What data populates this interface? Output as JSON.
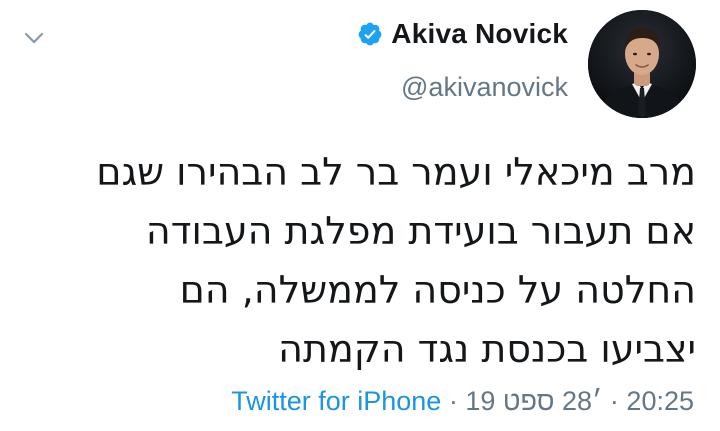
{
  "tweet": {
    "author": {
      "display_name": "Akiva Novick",
      "handle": "@akivanovick",
      "verified": true,
      "avatar_icon": "profile-photo"
    },
    "text_lines": [
      "מרב מיכאלי ועמר בר לב הבהירו שגם",
      "אם תעבור בועידת מפלגת העבודה",
      "החלטה על כניסה לממשלה, הם",
      "יצביעו בכנסת נגד הקמתה"
    ],
    "time": "20:25",
    "date": "19 ׳28 ספט",
    "source": "Twitter for iPhone",
    "separator": "·",
    "menu_icon": "chevron-down-icon",
    "colors": {
      "text": "#14171a",
      "secondary": "#657786",
      "link": "#1b95e0",
      "verified": "#1da1f2"
    }
  }
}
